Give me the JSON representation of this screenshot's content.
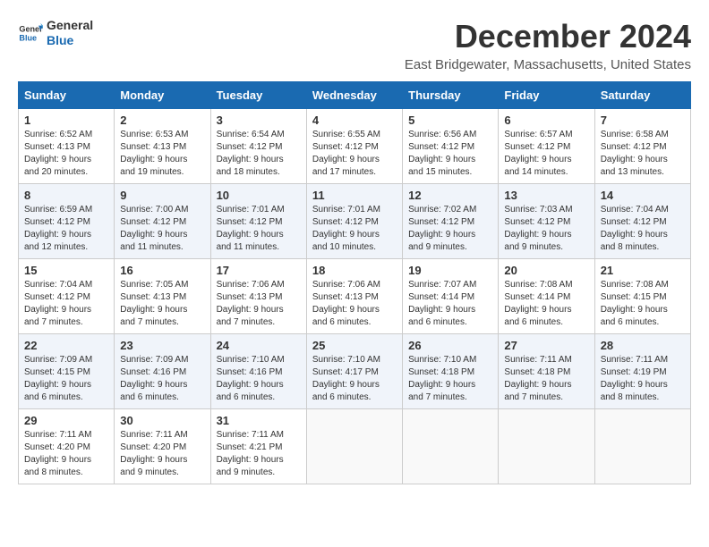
{
  "logo": {
    "text_general": "General",
    "text_blue": "Blue"
  },
  "title": "December 2024",
  "subtitle": "East Bridgewater, Massachusetts, United States",
  "header_days": [
    "Sunday",
    "Monday",
    "Tuesday",
    "Wednesday",
    "Thursday",
    "Friday",
    "Saturday"
  ],
  "weeks": [
    [
      {
        "day": "1",
        "sunrise": "6:52 AM",
        "sunset": "4:13 PM",
        "daylight": "9 hours and 20 minutes."
      },
      {
        "day": "2",
        "sunrise": "6:53 AM",
        "sunset": "4:13 PM",
        "daylight": "9 hours and 19 minutes."
      },
      {
        "day": "3",
        "sunrise": "6:54 AM",
        "sunset": "4:12 PM",
        "daylight": "9 hours and 18 minutes."
      },
      {
        "day": "4",
        "sunrise": "6:55 AM",
        "sunset": "4:12 PM",
        "daylight": "9 hours and 17 minutes."
      },
      {
        "day": "5",
        "sunrise": "6:56 AM",
        "sunset": "4:12 PM",
        "daylight": "9 hours and 15 minutes."
      },
      {
        "day": "6",
        "sunrise": "6:57 AM",
        "sunset": "4:12 PM",
        "daylight": "9 hours and 14 minutes."
      },
      {
        "day": "7",
        "sunrise": "6:58 AM",
        "sunset": "4:12 PM",
        "daylight": "9 hours and 13 minutes."
      }
    ],
    [
      {
        "day": "8",
        "sunrise": "6:59 AM",
        "sunset": "4:12 PM",
        "daylight": "9 hours and 12 minutes."
      },
      {
        "day": "9",
        "sunrise": "7:00 AM",
        "sunset": "4:12 PM",
        "daylight": "9 hours and 11 minutes."
      },
      {
        "day": "10",
        "sunrise": "7:01 AM",
        "sunset": "4:12 PM",
        "daylight": "9 hours and 11 minutes."
      },
      {
        "day": "11",
        "sunrise": "7:01 AM",
        "sunset": "4:12 PM",
        "daylight": "9 hours and 10 minutes."
      },
      {
        "day": "12",
        "sunrise": "7:02 AM",
        "sunset": "4:12 PM",
        "daylight": "9 hours and 9 minutes."
      },
      {
        "day": "13",
        "sunrise": "7:03 AM",
        "sunset": "4:12 PM",
        "daylight": "9 hours and 9 minutes."
      },
      {
        "day": "14",
        "sunrise": "7:04 AM",
        "sunset": "4:12 PM",
        "daylight": "9 hours and 8 minutes."
      }
    ],
    [
      {
        "day": "15",
        "sunrise": "7:04 AM",
        "sunset": "4:12 PM",
        "daylight": "9 hours and 7 minutes."
      },
      {
        "day": "16",
        "sunrise": "7:05 AM",
        "sunset": "4:13 PM",
        "daylight": "9 hours and 7 minutes."
      },
      {
        "day": "17",
        "sunrise": "7:06 AM",
        "sunset": "4:13 PM",
        "daylight": "9 hours and 7 minutes."
      },
      {
        "day": "18",
        "sunrise": "7:06 AM",
        "sunset": "4:13 PM",
        "daylight": "9 hours and 6 minutes."
      },
      {
        "day": "19",
        "sunrise": "7:07 AM",
        "sunset": "4:14 PM",
        "daylight": "9 hours and 6 minutes."
      },
      {
        "day": "20",
        "sunrise": "7:08 AM",
        "sunset": "4:14 PM",
        "daylight": "9 hours and 6 minutes."
      },
      {
        "day": "21",
        "sunrise": "7:08 AM",
        "sunset": "4:15 PM",
        "daylight": "9 hours and 6 minutes."
      }
    ],
    [
      {
        "day": "22",
        "sunrise": "7:09 AM",
        "sunset": "4:15 PM",
        "daylight": "9 hours and 6 minutes."
      },
      {
        "day": "23",
        "sunrise": "7:09 AM",
        "sunset": "4:16 PM",
        "daylight": "9 hours and 6 minutes."
      },
      {
        "day": "24",
        "sunrise": "7:10 AM",
        "sunset": "4:16 PM",
        "daylight": "9 hours and 6 minutes."
      },
      {
        "day": "25",
        "sunrise": "7:10 AM",
        "sunset": "4:17 PM",
        "daylight": "9 hours and 6 minutes."
      },
      {
        "day": "26",
        "sunrise": "7:10 AM",
        "sunset": "4:18 PM",
        "daylight": "9 hours and 7 minutes."
      },
      {
        "day": "27",
        "sunrise": "7:11 AM",
        "sunset": "4:18 PM",
        "daylight": "9 hours and 7 minutes."
      },
      {
        "day": "28",
        "sunrise": "7:11 AM",
        "sunset": "4:19 PM",
        "daylight": "9 hours and 8 minutes."
      }
    ],
    [
      {
        "day": "29",
        "sunrise": "7:11 AM",
        "sunset": "4:20 PM",
        "daylight": "9 hours and 8 minutes."
      },
      {
        "day": "30",
        "sunrise": "7:11 AM",
        "sunset": "4:20 PM",
        "daylight": "9 hours and 9 minutes."
      },
      {
        "day": "31",
        "sunrise": "7:11 AM",
        "sunset": "4:21 PM",
        "daylight": "9 hours and 9 minutes."
      },
      null,
      null,
      null,
      null
    ]
  ]
}
